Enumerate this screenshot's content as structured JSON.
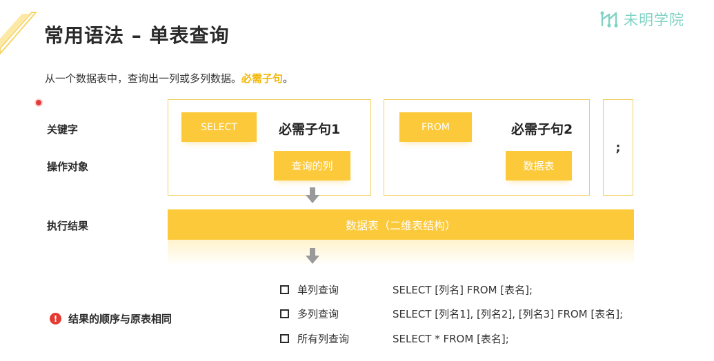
{
  "slide": {
    "title": "常用语法 – 单表查询",
    "subtitle": "从一个数据表中，查询出一列或多列数据。",
    "subtitle_highlight": "必需子句",
    "subtitle_end": "。",
    "brand": {
      "name": "未明学院",
      "icon": "brand-logo-icon",
      "color": "#7fd3c4"
    }
  },
  "row_labels": {
    "keyword": "关键字",
    "operand": "操作对象",
    "result": "执行结果"
  },
  "clauses": [
    {
      "keyword": "SELECT",
      "title": "必需子句1",
      "operand": "查询的列"
    },
    {
      "keyword": "FROM",
      "title": "必需子句2",
      "operand": "数据表"
    }
  ],
  "terminator": ";",
  "result": {
    "label": "数据表（二维表结构）"
  },
  "note": {
    "icon": "warning-icon",
    "text": "结果的顺序与原表相同"
  },
  "syntax": [
    {
      "name": "单列查询",
      "code": "SELECT [列名] FROM [表名];"
    },
    {
      "name": "多列查询",
      "code": "SELECT [列名1], [列名2], [列名3] FROM [表名];"
    },
    {
      "name": "所有列查询",
      "code": "SELECT * FROM [表名];"
    }
  ],
  "colors": {
    "accent": "#fcc93a",
    "border": "#f3cf62",
    "warning": "#e53a32"
  }
}
